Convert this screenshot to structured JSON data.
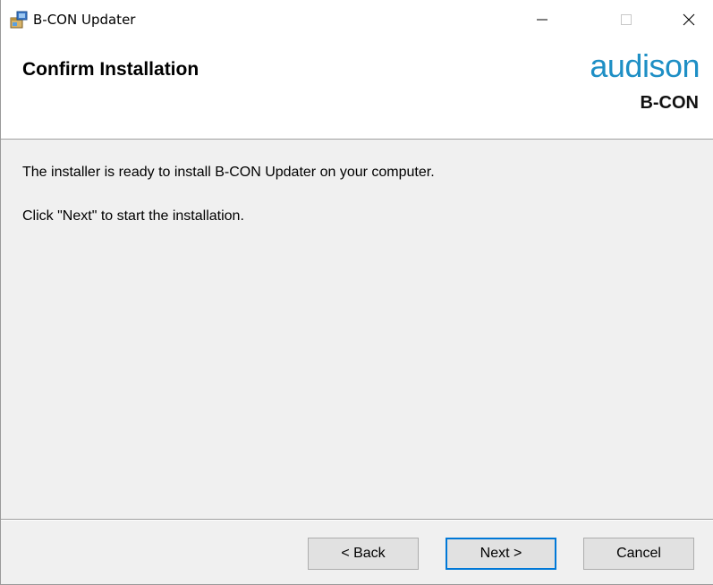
{
  "window": {
    "title": "B-CON Updater",
    "icon": "installer-app-icon",
    "controls": {
      "minimize_icon": "minimize-icon",
      "maximize_icon": "maximize-icon",
      "close_icon": "close-icon"
    }
  },
  "banner": {
    "title": "Confirm Installation",
    "brand_name": "audison",
    "brand_product": "B-CON"
  },
  "content": {
    "line1": "The installer is ready to install B-CON Updater on your computer.",
    "line2": "Click \"Next\" to start the installation."
  },
  "footer": {
    "back_label": "< Back",
    "next_label": "Next >",
    "cancel_label": "Cancel"
  },
  "colors": {
    "brand_blue": "#1e8fc5",
    "focus_border": "#0078d7",
    "dialog_background": "#f0f0f0"
  }
}
